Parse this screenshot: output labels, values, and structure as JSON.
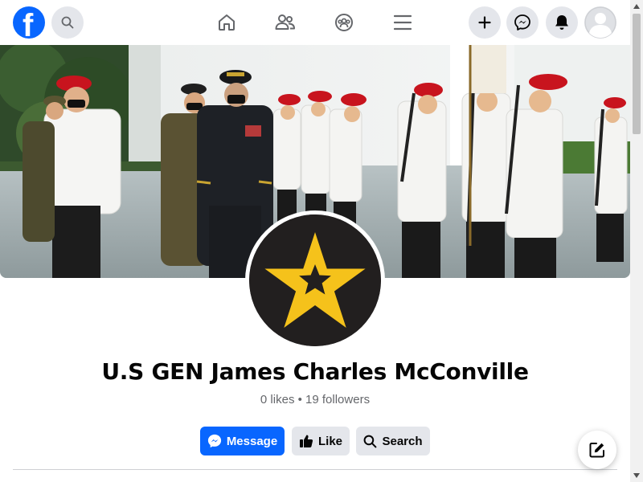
{
  "header": {
    "logo_letter": "f",
    "icons": {
      "search": "search-icon",
      "home": "home-icon",
      "friends": "friends-icon",
      "groups": "groups-icon",
      "menu": "hamburger-menu-icon",
      "create": "plus-icon",
      "messenger": "messenger-icon",
      "notifications": "bell-icon",
      "account": "avatar-icon"
    }
  },
  "profile": {
    "name": "U.S GEN James Charles McConville",
    "stats": "0 likes • 19 followers"
  },
  "actions": {
    "message": "Message",
    "like": "Like",
    "search": "Search"
  },
  "colors": {
    "brand": "#0866ff",
    "star": "#f5c21b",
    "profile_bg": "#221f1f",
    "secondary_button": "#e4e6eb"
  }
}
